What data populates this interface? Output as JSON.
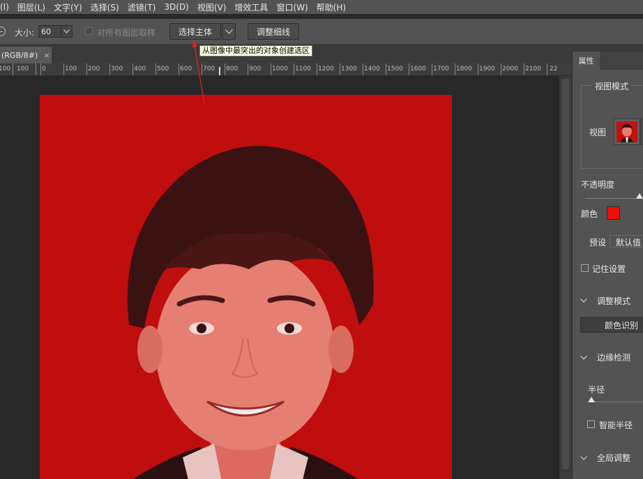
{
  "menu": {
    "items": [
      "(I)",
      "图层(L)",
      "文字(Y)",
      "选择(S)",
      "滤镜(T)",
      "3D(D)",
      "视图(V)",
      "增效工具",
      "窗口(W)",
      "帮助(H)"
    ]
  },
  "options": {
    "size_label": "大小:",
    "size_value": "60",
    "sample_all_label": "对所有图层取样",
    "select_subject": "选择主体",
    "refine_edge": "调整细线"
  },
  "tooltip": "从图像中最突出的对象创建选区",
  "doc_tab": {
    "label": "(RGB/8#)",
    "close": "×"
  },
  "ruler": {
    "labels": [
      "100",
      "100",
      "0",
      "100",
      "200",
      "300",
      "400",
      "500",
      "600",
      "700",
      "800",
      "900",
      "1000",
      "1100",
      "1200",
      "1300",
      "1400",
      "1500",
      "1600",
      "1700",
      "1800",
      "1900",
      "2000",
      "2100",
      "22"
    ]
  },
  "panel": {
    "tab": "属性",
    "view_mode_title": "视图模式",
    "view_label": "视图",
    "opacity_label": "不透明度",
    "color_label": "颜色",
    "overlay_color": "#f20d0d",
    "preset_label": "预设",
    "preset_value": "默认值",
    "remember_label": "记住设置",
    "adjust_mode_label": "调整模式",
    "adjust_mode_value": "颜色识别",
    "edge_detection_label": "边缘检测",
    "radius_label": "半径",
    "smart_radius_label": "智能半径",
    "global_refine_label": "全局调整"
  },
  "colors": {
    "ui_bg": "#535353",
    "canvas_bg": "#282828",
    "photo_overlay": "#c00d0d"
  }
}
